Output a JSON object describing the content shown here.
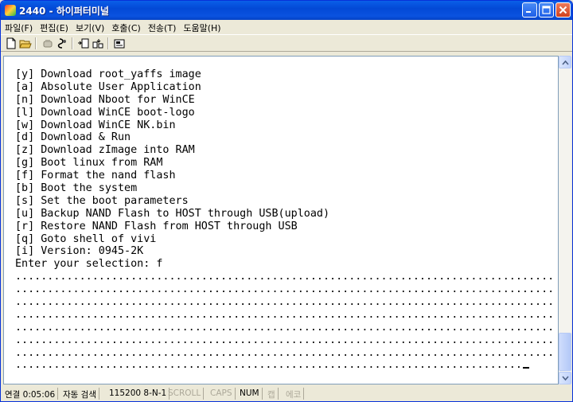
{
  "window": {
    "title": "2440 - 하이퍼터미널"
  },
  "menu": [
    {
      "label": "파일(F)"
    },
    {
      "label": "편집(E)"
    },
    {
      "label": "보기(V)"
    },
    {
      "label": "호출(C)"
    },
    {
      "label": "전송(T)"
    },
    {
      "label": "도움말(H)"
    }
  ],
  "toolbar": {
    "icons": [
      "new-icon",
      "open-icon",
      "connect-icon",
      "disconnect-icon",
      "send-icon",
      "receive-icon",
      "properties-icon"
    ]
  },
  "terminal": {
    "lines": [
      "[y] Download root_yaffs image",
      "[a] Absolute User Application",
      "[n] Download Nboot for WinCE",
      "[l] Download WinCE boot-logo",
      "[w] Download WinCE NK.bin",
      "[d] Download & Run",
      "[z] Download zImage into RAM",
      "[g] Boot linux from RAM",
      "[f] Format the nand flash",
      "[b] Boot the system",
      "[s] Set the boot parameters",
      "[u] Backup NAND Flash to HOST through USB(upload)",
      "[r] Restore NAND Flash from HOST through USB",
      "[q] Goto shell of vivi",
      "[i] Version: 0945-2K",
      "Enter your selection: f",
      "..........................................................................................",
      "..........................................................................................",
      "..........................................................................................",
      "..........................................................................................",
      "..........................................................................................",
      "..........................................................................................",
      "..........................................................................................",
      "..............................................................................."
    ]
  },
  "status": {
    "connected": "연결 0:05:06",
    "autodetect": "자동 검색",
    "settings": "115200 8-N-1",
    "scroll": "SCROLL",
    "caps": "CAPS",
    "num": "NUM",
    "capture": "캡",
    "echo": "에코"
  }
}
